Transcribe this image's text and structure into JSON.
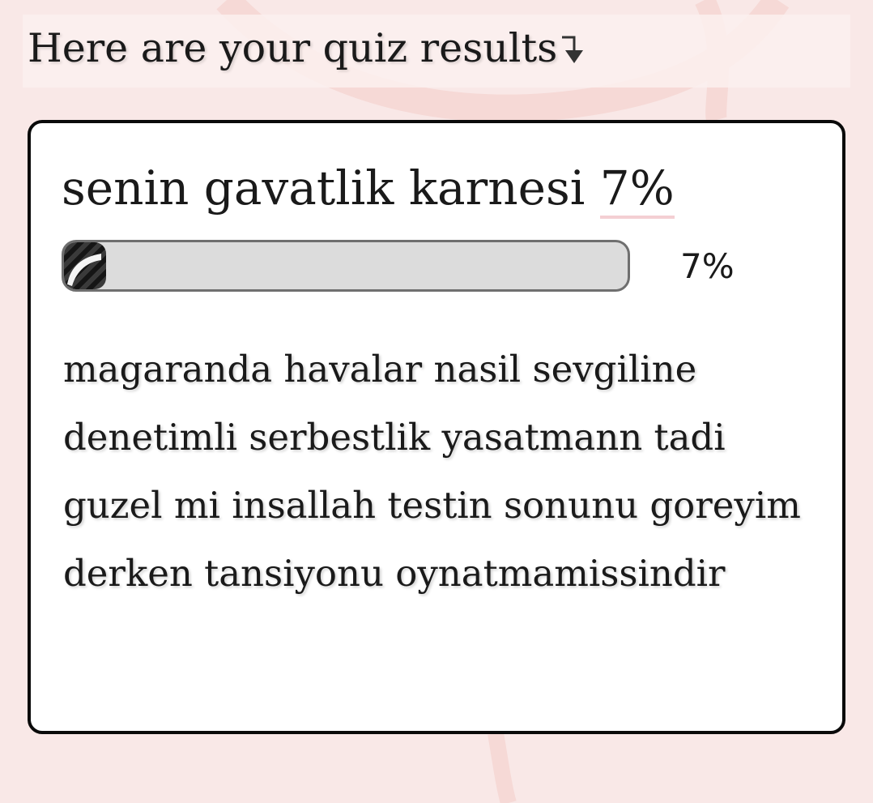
{
  "header": {
    "title": "Here are your quiz results"
  },
  "result": {
    "title": "senin gavatlik karnesi",
    "score_text": "7%",
    "progress_value": 7,
    "progress_label": "7%",
    "description": "magaranda havalar nasil sevgiline denetimli serbestlik yasatmann tadi guzel mi insallah testin sonunu goreyim derken tansiyonu oynatmamissindir"
  },
  "icons": {
    "header_arrow": "arrow-down-right-icon"
  },
  "colors": {
    "background": "#f9e8e7",
    "card_border": "#0a0a0a",
    "progress_track": "#dcdcdc",
    "progress_fill": "#151515",
    "score_underline": "#f4cfd3"
  }
}
